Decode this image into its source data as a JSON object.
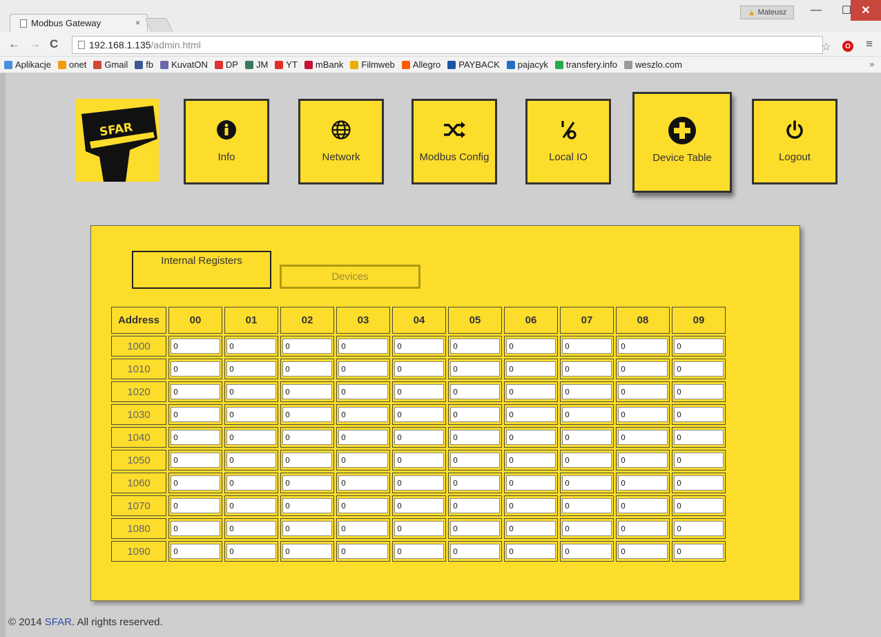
{
  "browser": {
    "tab_title": "Modbus Gateway",
    "tab_close": "×",
    "profile_name": "Mateusz",
    "url_host": "192.168.1.135",
    "url_path": "/admin.html",
    "bookmarks": [
      {
        "label": "Aplikacje",
        "icon": "apps-grid-icon",
        "color": "#4a8fdc"
      },
      {
        "label": "onet",
        "icon": "onet-icon",
        "color": "#f29c11"
      },
      {
        "label": "Gmail",
        "icon": "gmail-icon",
        "color": "#d14836"
      },
      {
        "label": "fb",
        "icon": "facebook-icon",
        "color": "#3b5998"
      },
      {
        "label": "KuvatON",
        "icon": "kuvaton-icon",
        "color": "#6a6aaa"
      },
      {
        "label": "DP",
        "icon": "dp-icon",
        "color": "#d33"
      },
      {
        "label": "JM",
        "icon": "jm-icon",
        "color": "#3a7a5a"
      },
      {
        "label": "YT",
        "icon": "youtube-icon",
        "color": "#e52d27"
      },
      {
        "label": "mBank",
        "icon": "mbank-icon",
        "color": "#c4122f"
      },
      {
        "label": "Filmweb",
        "icon": "filmweb-icon",
        "color": "#e5b100"
      },
      {
        "label": "Allegro",
        "icon": "allegro-icon",
        "color": "#ff5a00"
      },
      {
        "label": "PAYBACK",
        "icon": "payback-icon",
        "color": "#1b55a5"
      },
      {
        "label": "pajacyk",
        "icon": "pajacyk-icon",
        "color": "#1f6fbf"
      },
      {
        "label": "transfery.info",
        "icon": "transfery-icon",
        "color": "#2aa845"
      },
      {
        "label": "weszlo.com",
        "icon": "page-icon",
        "color": "#999999"
      }
    ]
  },
  "nav": {
    "tiles": [
      {
        "label": "Info",
        "icon": "info-icon"
      },
      {
        "label": "Network",
        "icon": "globe-icon"
      },
      {
        "label": "Modbus Config",
        "icon": "shuffle-icon"
      },
      {
        "label": "Local IO",
        "icon": "percent-icon"
      },
      {
        "label": "Device Table",
        "icon": "plus-circle-icon"
      },
      {
        "label": "Logout",
        "icon": "power-icon"
      }
    ],
    "active": "Device Table"
  },
  "logo": {
    "text": "SFAR"
  },
  "panel": {
    "tabs": {
      "internal": "Internal Registers",
      "devices": "Devices"
    },
    "table": {
      "address_header": "Address",
      "columns": [
        "00",
        "01",
        "02",
        "03",
        "04",
        "05",
        "06",
        "07",
        "08",
        "09"
      ],
      "rows": [
        {
          "address": "1000",
          "values": [
            "0",
            "0",
            "0",
            "0",
            "0",
            "0",
            "0",
            "0",
            "0",
            "0"
          ]
        },
        {
          "address": "1010",
          "values": [
            "0",
            "0",
            "0",
            "0",
            "0",
            "0",
            "0",
            "0",
            "0",
            "0"
          ]
        },
        {
          "address": "1020",
          "values": [
            "0",
            "0",
            "0",
            "0",
            "0",
            "0",
            "0",
            "0",
            "0",
            "0"
          ]
        },
        {
          "address": "1030",
          "values": [
            "0",
            "0",
            "0",
            "0",
            "0",
            "0",
            "0",
            "0",
            "0",
            "0"
          ]
        },
        {
          "address": "1040",
          "values": [
            "0",
            "0",
            "0",
            "0",
            "0",
            "0",
            "0",
            "0",
            "0",
            "0"
          ]
        },
        {
          "address": "1050",
          "values": [
            "0",
            "0",
            "0",
            "0",
            "0",
            "0",
            "0",
            "0",
            "0",
            "0"
          ]
        },
        {
          "address": "1060",
          "values": [
            "0",
            "0",
            "0",
            "0",
            "0",
            "0",
            "0",
            "0",
            "0",
            "0"
          ]
        },
        {
          "address": "1070",
          "values": [
            "0",
            "0",
            "0",
            "0",
            "0",
            "0",
            "0",
            "0",
            "0",
            "0"
          ]
        },
        {
          "address": "1080",
          "values": [
            "0",
            "0",
            "0",
            "0",
            "0",
            "0",
            "0",
            "0",
            "0",
            "0"
          ]
        },
        {
          "address": "1090",
          "values": [
            "0",
            "0",
            "0",
            "0",
            "0",
            "0",
            "0",
            "0",
            "0",
            "0"
          ]
        }
      ]
    }
  },
  "footer": {
    "prefix": "© 2014 ",
    "brand": "SFAR",
    "suffix": ". All rights reserved."
  },
  "colors": {
    "accent": "#fddd2b",
    "border": "#333333",
    "link": "#2f4ea8"
  }
}
